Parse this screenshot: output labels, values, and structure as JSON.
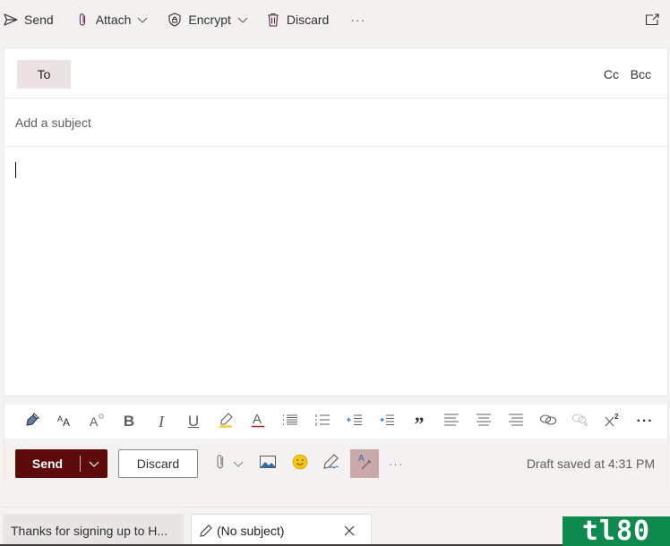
{
  "command_bar": {
    "send_label": "Send",
    "attach_label": "Attach",
    "encrypt_label": "Encrypt",
    "discard_label": "Discard",
    "more_label": "···",
    "icons": {
      "send": "send-icon",
      "attach": "paperclip-icon",
      "encrypt": "shield-lock-icon",
      "discard": "trash-icon",
      "popout": "popout-icon"
    }
  },
  "compose": {
    "to_label": "To",
    "cc_label": "Cc",
    "bcc_label": "Bcc",
    "to_value": "",
    "subject_value": "",
    "subject_placeholder": "Add a subject",
    "body_value": ""
  },
  "format_toolbar": {
    "items": [
      {
        "name": "format-painter",
        "icon": "paintbrush-icon"
      },
      {
        "name": "font-size",
        "icon": "font-size-icon"
      },
      {
        "name": "font-style",
        "icon": "text-effects-icon"
      },
      {
        "name": "bold",
        "icon": "bold-icon",
        "glyph": "B"
      },
      {
        "name": "italic",
        "icon": "italic-icon",
        "glyph": "I"
      },
      {
        "name": "underline",
        "icon": "underline-icon",
        "glyph": "U"
      },
      {
        "name": "highlight",
        "icon": "highlighter-icon"
      },
      {
        "name": "font-color",
        "icon": "font-color-icon",
        "glyph": "A"
      },
      {
        "name": "bullets",
        "icon": "bullet-list-icon"
      },
      {
        "name": "numbering",
        "icon": "numbered-list-icon"
      },
      {
        "name": "decrease-indent",
        "icon": "outdent-icon"
      },
      {
        "name": "increase-indent",
        "icon": "indent-icon"
      },
      {
        "name": "quote",
        "icon": "quote-icon",
        "glyph": "”"
      },
      {
        "name": "align-left",
        "icon": "align-left-icon"
      },
      {
        "name": "align-center",
        "icon": "align-center-icon"
      },
      {
        "name": "align-right",
        "icon": "align-right-icon"
      },
      {
        "name": "insert-link",
        "icon": "link-icon"
      },
      {
        "name": "remove-link",
        "icon": "unlink-icon"
      },
      {
        "name": "superscript",
        "icon": "superscript-icon"
      },
      {
        "name": "more-options",
        "icon": "more-icon",
        "glyph": "···"
      }
    ]
  },
  "footer": {
    "send_label": "Send",
    "discard_label": "Discard",
    "more_label": "···",
    "draft_status": "Draft saved at 4:31 PM",
    "icons": {
      "attach": "paperclip-icon",
      "picture": "picture-icon",
      "emoji": "emoji-icon",
      "signature": "signature-pen-icon",
      "editor": "editor-icon"
    }
  },
  "tabs": [
    {
      "label": "Thanks for signing up to H...",
      "active": false
    },
    {
      "label": "(No subject)",
      "active": true
    }
  ],
  "watermark": "tl80",
  "colors": {
    "send_primary": "#5c0a0a",
    "to_button_bg": "#ede3e3",
    "editor_active_bg": "#c9a9a9",
    "watermark_bg": "#0f8a4f"
  }
}
